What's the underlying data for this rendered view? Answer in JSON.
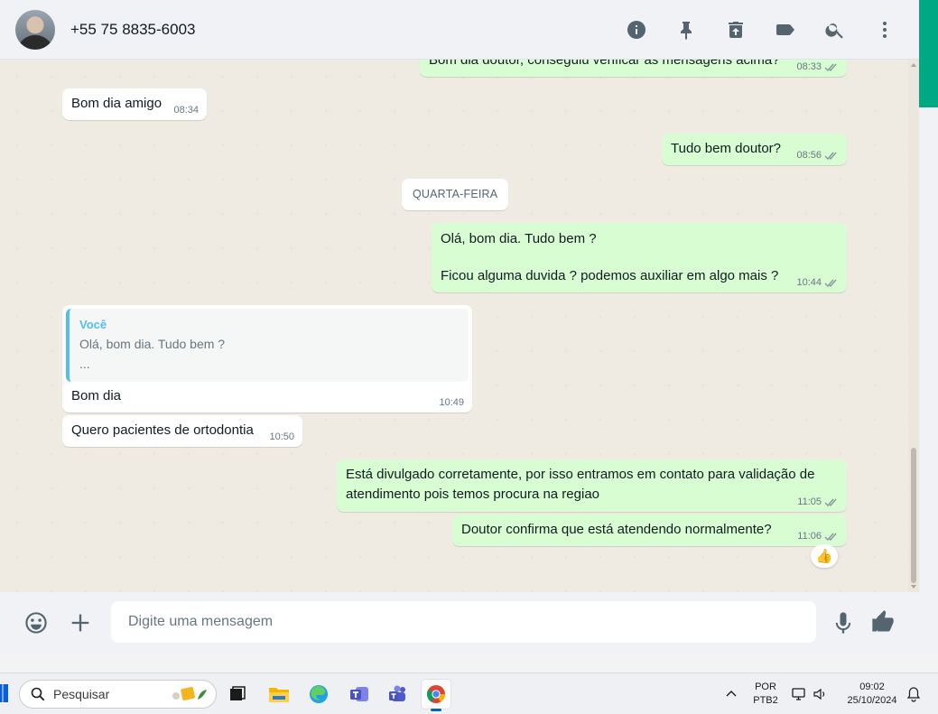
{
  "header": {
    "contact_name": "+55 75 8835-6003"
  },
  "messages": [
    {
      "id": "m1",
      "direction": "out",
      "text": "Bom dia doutor, conseguiu verificar as mensagens acima?",
      "time": "08:33",
      "ticks": true
    },
    {
      "id": "m2",
      "direction": "in",
      "text": "Bom dia amigo",
      "time": "08:34"
    },
    {
      "id": "m3",
      "direction": "out",
      "text": "Tudo bem doutor?",
      "time": "08:56",
      "ticks": true
    },
    {
      "id": "m4",
      "direction": "out",
      "lines": [
        "Olá, bom dia. Tudo bem ?",
        "Ficou alguma duvida ? podemos auxiliar em algo mais ?"
      ],
      "time": "10:44",
      "ticks": true
    },
    {
      "id": "m5",
      "direction": "in",
      "quote_author": "Você",
      "quote_line1": "Olá, bom dia. Tudo bem ?",
      "quote_line2": "...",
      "text": "Bom dia",
      "time": "10:49"
    },
    {
      "id": "m6",
      "direction": "in",
      "text": "Quero pacientes de ortodontia",
      "time": "10:50"
    },
    {
      "id": "m7",
      "direction": "out",
      "text": "Está divulgado corretamente, por isso entramos em contato para validação de atendimento pois temos procura na regiao",
      "time": "11:05",
      "ticks": true
    },
    {
      "id": "m8",
      "direction": "out",
      "text": "Doutor confirma que está atendendo normalmente?",
      "time": "11:06",
      "ticks": true,
      "reaction": "👍"
    }
  ],
  "day_separator": "QUARTA-FEIRA",
  "composer": {
    "placeholder": "Digite uma mensagem"
  },
  "taskbar": {
    "search_label": "Pesquisar",
    "lang_line1": "POR",
    "lang_line2": "PTB2",
    "time": "09:02",
    "date": "25/10/2024"
  },
  "colors": {
    "outgoing_bubble": "#d9fdd3",
    "incoming_bubble": "#ffffff",
    "accent": "#00a884",
    "quote_bar": "#53bdeb",
    "chat_bg": "#efeae2"
  }
}
